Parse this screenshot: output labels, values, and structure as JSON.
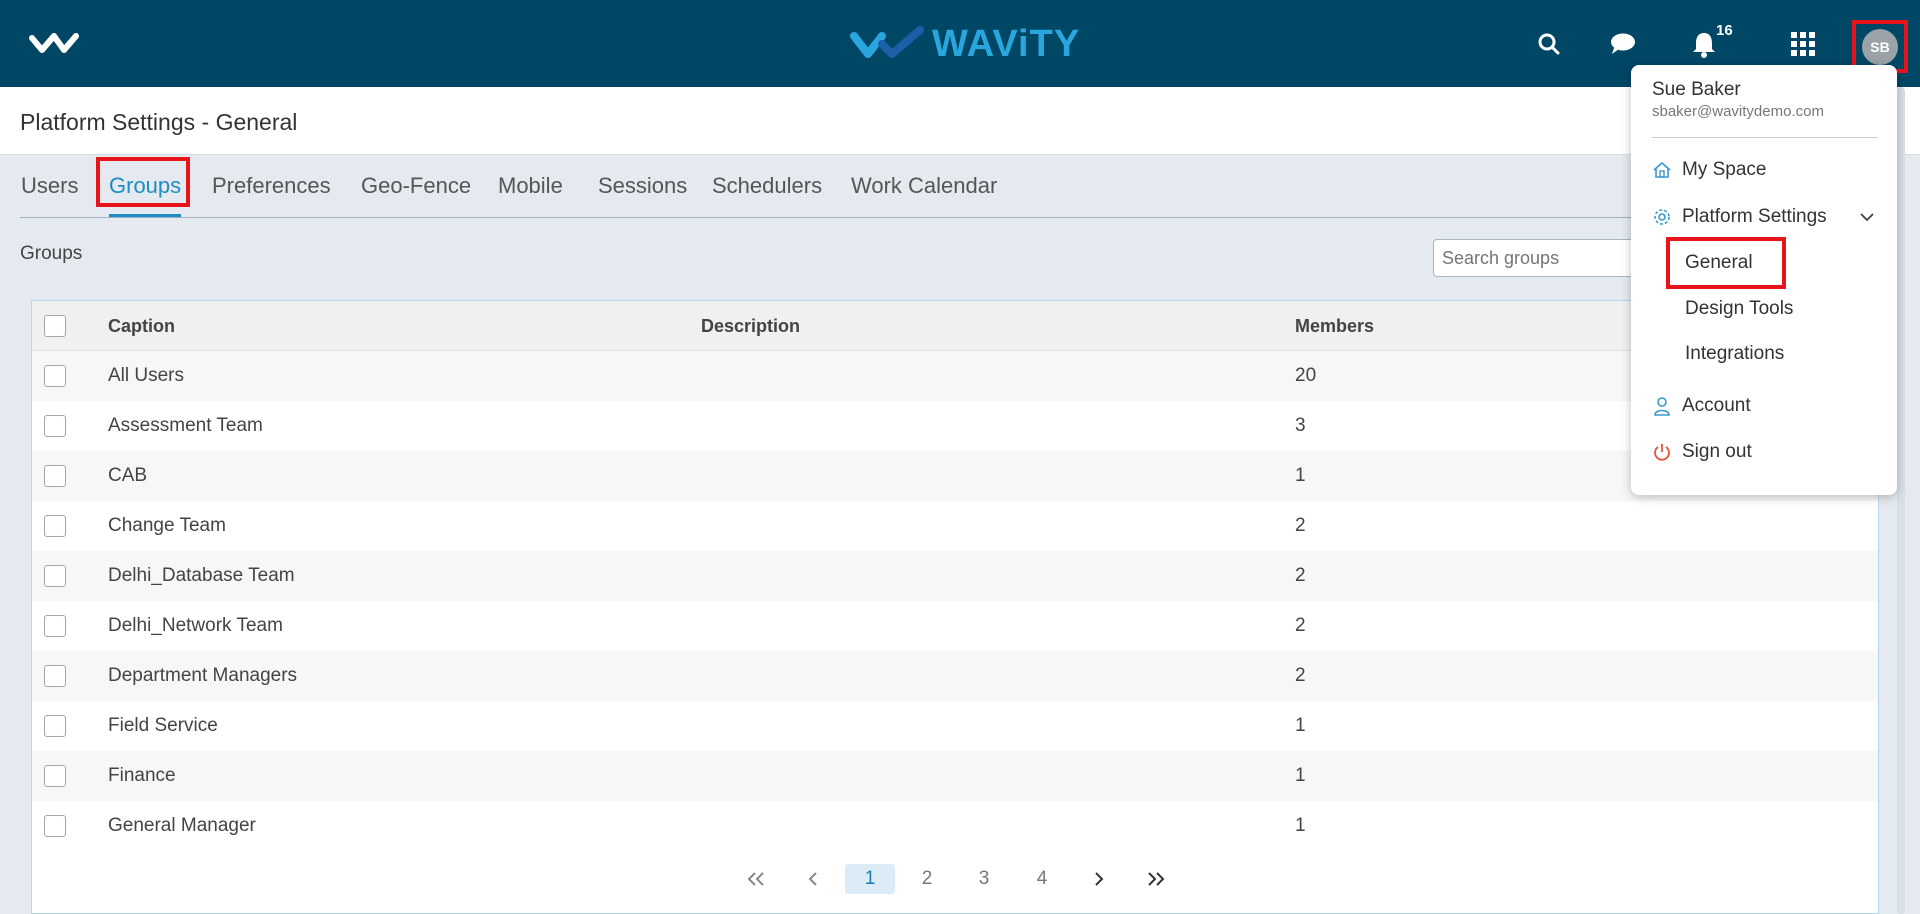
{
  "header": {
    "brand": "WAViTY",
    "notification_count": "16",
    "avatar_initials": "SB"
  },
  "page": {
    "title": "Platform Settings - General",
    "section_label": "Groups"
  },
  "tabs": [
    {
      "label": "Users"
    },
    {
      "label": "Groups"
    },
    {
      "label": "Preferences"
    },
    {
      "label": "Geo-Fence"
    },
    {
      "label": "Mobile"
    },
    {
      "label": "Sessions"
    },
    {
      "label": "Schedulers"
    },
    {
      "label": "Work Calendar"
    }
  ],
  "search": {
    "placeholder": "Search groups"
  },
  "table": {
    "columns": [
      "Caption",
      "Description",
      "Members"
    ],
    "rows": [
      {
        "caption": "All Users",
        "description": "",
        "members": "20"
      },
      {
        "caption": "Assessment Team",
        "description": "",
        "members": "3"
      },
      {
        "caption": "CAB",
        "description": "",
        "members": "1"
      },
      {
        "caption": "Change Team",
        "description": "",
        "members": "2"
      },
      {
        "caption": "Delhi_Database Team",
        "description": "",
        "members": "2"
      },
      {
        "caption": "Delhi_Network Team",
        "description": "",
        "members": "2"
      },
      {
        "caption": "Department Managers",
        "description": "",
        "members": "2"
      },
      {
        "caption": "Field Service",
        "description": "",
        "members": "1"
      },
      {
        "caption": "Finance",
        "description": "",
        "members": "1"
      },
      {
        "caption": "General Manager",
        "description": "",
        "members": "1"
      }
    ]
  },
  "pagination": {
    "pages": [
      "1",
      "2",
      "3",
      "4"
    ],
    "current": "1"
  },
  "user_menu": {
    "name": "Sue Baker",
    "email": "sbaker@wavitydemo.com",
    "my_space": "My Space",
    "platform_settings": "Platform Settings",
    "sub_items": [
      "General",
      "Design Tools",
      "Integrations"
    ],
    "account": "Account",
    "sign_out": "Sign out"
  },
  "colors": {
    "topbar": "#004766",
    "accent": "#1f8dc3",
    "highlight": "#e8141c"
  }
}
